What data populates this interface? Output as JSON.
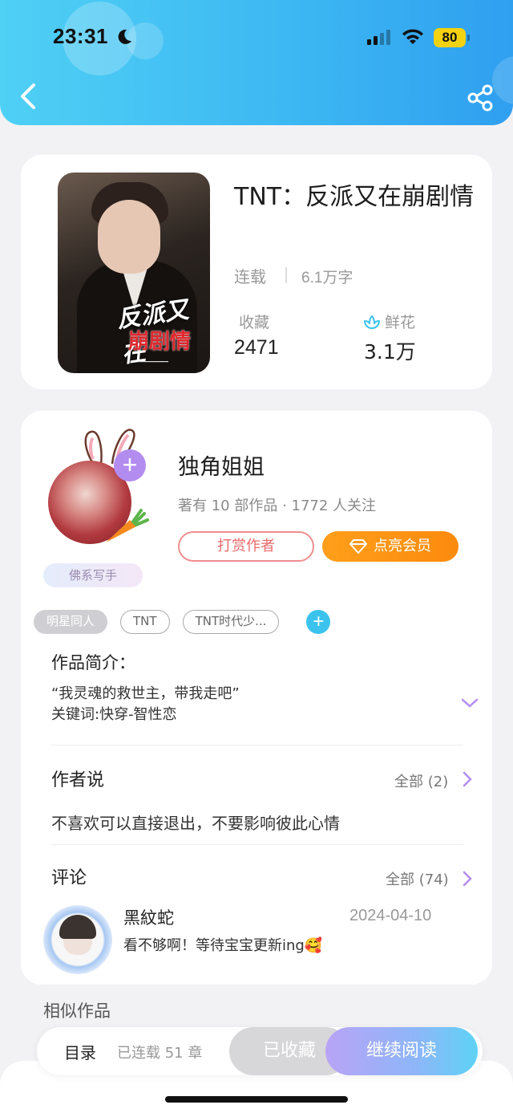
{
  "status_bar": {
    "time": "23:31",
    "battery": "80"
  },
  "book": {
    "title": "TNT：反派又在崩剧情",
    "status": "连载",
    "word_count": "6.1万字",
    "favorites_label": "收藏",
    "favorites_value": "2471",
    "flowers_label": "鲜花",
    "flowers_value": "3.1万"
  },
  "author": {
    "name": "独角姐姐",
    "meta": "著有 10 部作品 · 1772 人关注",
    "badge": "佛系写手",
    "tip_button": "打赏作者",
    "vip_button": "点亮会员"
  },
  "tags": [
    "明星同人",
    "TNT",
    "TNT时代少..."
  ],
  "intro": {
    "label": "作品简介：",
    "line1": "“我灵魂的救世主，带我走吧”",
    "line2": "关键词:快穿-智性恋"
  },
  "author_says": {
    "title": "作者说",
    "more": "全部 (2)",
    "text": "不喜欢可以直接退出，不要影响彼此心情"
  },
  "comments": {
    "title": "评论",
    "more": "全部 (74)",
    "items": [
      {
        "name": "黑紋蛇",
        "date": "2024-04-10",
        "text": "看不够啊！等待宝宝更新ing🥰"
      }
    ]
  },
  "similar_title": "相似作品",
  "bottom_bar": {
    "toc": "目录",
    "chapters": "已连载 51 章",
    "collected": "已收藏",
    "continue": "继续阅读"
  },
  "colors": {
    "header": "#3cb6f2",
    "vip": "#fb8a0e",
    "tip": "#ea6a6a",
    "accent_purple": "#b38cf0"
  }
}
